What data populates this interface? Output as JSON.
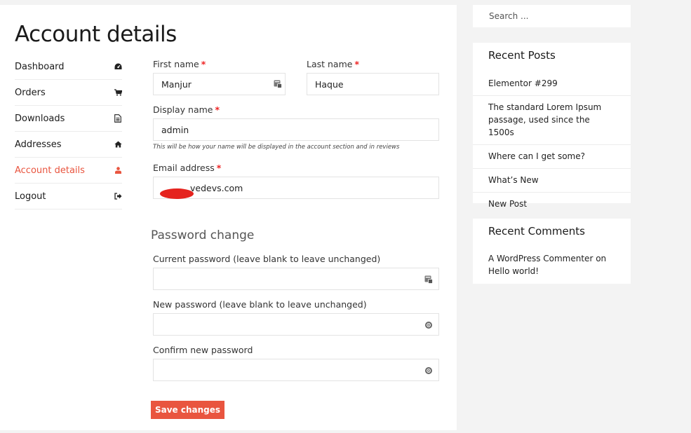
{
  "page": {
    "title": "Account details"
  },
  "nav": {
    "items": [
      {
        "label": "Dashboard",
        "icon": "dashboard-icon"
      },
      {
        "label": "Orders",
        "icon": "cart-icon"
      },
      {
        "label": "Downloads",
        "icon": "file-icon"
      },
      {
        "label": "Addresses",
        "icon": "home-icon"
      },
      {
        "label": "Account details",
        "icon": "user-icon",
        "active": true
      },
      {
        "label": "Logout",
        "icon": "sign-out-icon"
      }
    ],
    "active_color": "#e9553f"
  },
  "form": {
    "required_mark": "*",
    "first_name": {
      "label": "First name",
      "value": "Manjur"
    },
    "last_name": {
      "label": "Last name",
      "value": "Haque"
    },
    "display_name": {
      "label": "Display name",
      "value": "admin",
      "hint": "This will be how your name will be displayed in the account section and in reviews"
    },
    "email": {
      "label": "Email address",
      "value_visible": "vedevs.com"
    },
    "password_section_title": "Password change",
    "current_password": {
      "label": "Current password (leave blank to leave unchanged)",
      "value": ""
    },
    "new_password": {
      "label": "New password (leave blank to leave unchanged)",
      "value": ""
    },
    "confirm_password": {
      "label": "Confirm new password",
      "value": ""
    },
    "save_label": "Save changes",
    "button_color": "#e9553f"
  },
  "sidebar": {
    "search_placeholder": "Search ...",
    "recent_posts": {
      "title": "Recent Posts",
      "items": [
        "Elementor #299",
        "The standard Lorem Ipsum passage, used since the 1500s",
        "Where can I get some?",
        "What’s New",
        "New Post"
      ]
    },
    "recent_comments": {
      "title": "Recent Comments",
      "author": "A WordPress Commenter",
      "on": "on",
      "post": "Hello world!"
    }
  }
}
